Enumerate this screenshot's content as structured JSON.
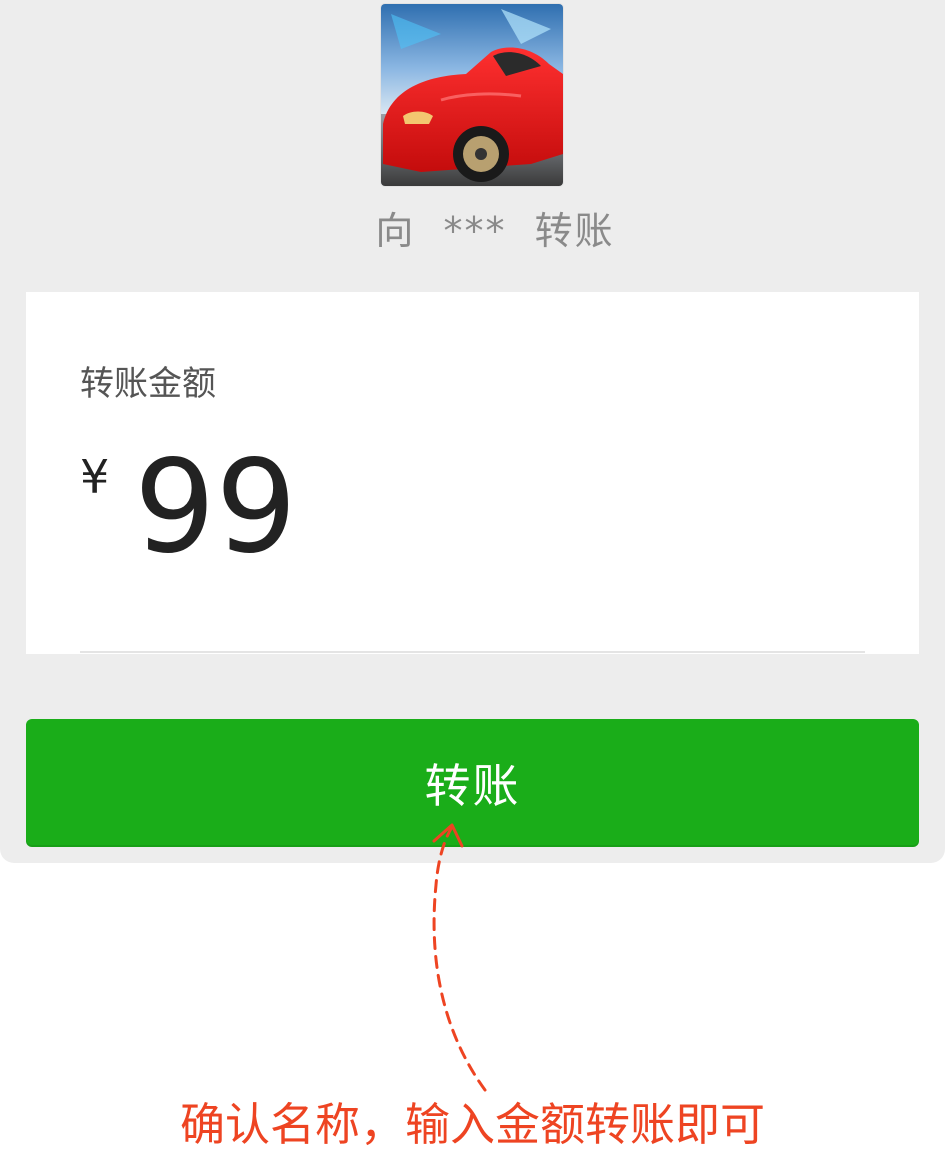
{
  "recipient": {
    "prefix": "向",
    "name": "***",
    "suffix": "转账"
  },
  "amount": {
    "label": "转账金额",
    "currency": "¥",
    "value": "99"
  },
  "transfer_button": {
    "label": "转账"
  },
  "annotation": {
    "text": "确认名称，输入金额转账即可"
  },
  "colors": {
    "background": "#ededed",
    "card": "#ffffff",
    "primary_button": "#1aad19",
    "annotation": "#ee4422"
  }
}
